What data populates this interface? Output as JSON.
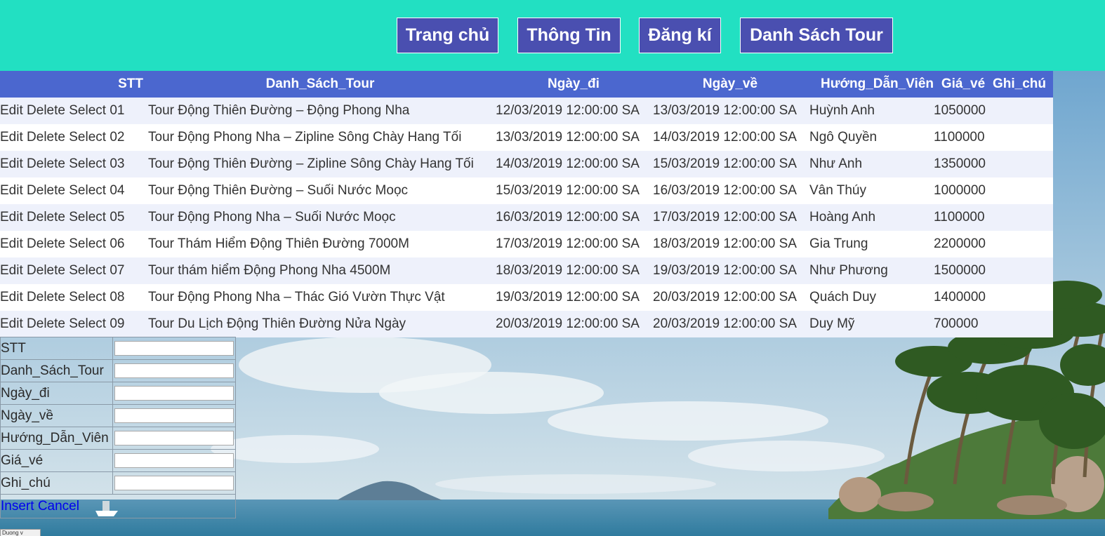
{
  "header": {
    "nav": [
      {
        "label": "Trang chủ"
      },
      {
        "label": "Thông Tin"
      },
      {
        "label": "Đăng kí"
      },
      {
        "label": "Danh Sách Tour"
      }
    ],
    "bg_color": "#22e0c2",
    "button_color": "#4a4fb0"
  },
  "table": {
    "header_color": "#4b67cf",
    "columns": [
      "STT",
      "Danh_Sách_Tour",
      "Ngày_đi",
      "Ngày_về",
      "Hướng_Dẫn_Viên",
      "Giá_vé",
      "Ghi_chú"
    ],
    "actions": {
      "edit": "Edit",
      "delete": "Delete",
      "select": "Select"
    },
    "rows": [
      {
        "stt": "01",
        "tour": "Tour Động Thiên Đường – Động Phong Nha",
        "ngay_di": "12/03/2019 12:00:00 SA",
        "ngay_ve": "13/03/2019 12:00:00 SA",
        "hdv": "Huỳnh Anh",
        "gia": "1050000",
        "ghi_chu": ""
      },
      {
        "stt": "02",
        "tour": "Tour Động Phong Nha – Zipline Sông Chày Hang Tối",
        "ngay_di": "13/03/2019 12:00:00 SA",
        "ngay_ve": "14/03/2019 12:00:00 SA",
        "hdv": "Ngô Quyền",
        "gia": "1100000",
        "ghi_chu": ""
      },
      {
        "stt": "03",
        "tour": "Tour Động Thiên Đường – Zipline Sông Chày Hang Tối",
        "ngay_di": "14/03/2019 12:00:00 SA",
        "ngay_ve": "15/03/2019 12:00:00 SA",
        "hdv": "Như Anh",
        "gia": "1350000",
        "ghi_chu": ""
      },
      {
        "stt": "04",
        "tour": "Tour Động Thiên Đường – Suối Nước Moọc",
        "ngay_di": "15/03/2019 12:00:00 SA",
        "ngay_ve": "16/03/2019 12:00:00 SA",
        "hdv": "Vân Thúy",
        "gia": "1000000",
        "ghi_chu": ""
      },
      {
        "stt": "05",
        "tour": "Tour Động Phong Nha – Suối Nước Moọc",
        "ngay_di": "16/03/2019 12:00:00 SA",
        "ngay_ve": "17/03/2019 12:00:00 SA",
        "hdv": "Hoàng Anh",
        "gia": "1100000",
        "ghi_chu": ""
      },
      {
        "stt": "06",
        "tour": "Tour Thám Hiểm Động Thiên Đường 7000M",
        "ngay_di": "17/03/2019 12:00:00 SA",
        "ngay_ve": "18/03/2019 12:00:00 SA",
        "hdv": "Gia Trung",
        "gia": "2200000",
        "ghi_chu": ""
      },
      {
        "stt": "07",
        "tour": "Tour thám hiểm Động Phong Nha 4500M",
        "ngay_di": "18/03/2019 12:00:00 SA",
        "ngay_ve": "19/03/2019 12:00:00 SA",
        "hdv": "Như Phương",
        "gia": "1500000",
        "ghi_chu": ""
      },
      {
        "stt": "08",
        "tour": "Tour Động Phong Nha – Thác Gió Vườn Thực Vật",
        "ngay_di": "19/03/2019 12:00:00 SA",
        "ngay_ve": "20/03/2019 12:00:00 SA",
        "hdv": "Quách Duy",
        "gia": "1400000",
        "ghi_chu": ""
      },
      {
        "stt": "09",
        "tour": "Tour Du Lịch Động Thiên Đường Nửa Ngày",
        "ngay_di": "20/03/2019 12:00:00 SA",
        "ngay_ve": "20/03/2019 12:00:00 SA",
        "hdv": "Duy Mỹ",
        "gia": "700000",
        "ghi_chu": ""
      }
    ]
  },
  "form": {
    "fields": [
      {
        "label": "STT",
        "value": ""
      },
      {
        "label": "Danh_Sách_Tour",
        "value": ""
      },
      {
        "label": "Ngày_đi",
        "value": ""
      },
      {
        "label": "Ngày_về",
        "value": ""
      },
      {
        "label": "Hướng_Dẫn_Viên",
        "value": ""
      },
      {
        "label": "Giá_vé",
        "value": ""
      },
      {
        "label": "Ghi_chú",
        "value": ""
      }
    ],
    "insert_label": "Insert",
    "cancel_label": "Cancel"
  },
  "footer_button": {
    "label": "Duong v"
  }
}
